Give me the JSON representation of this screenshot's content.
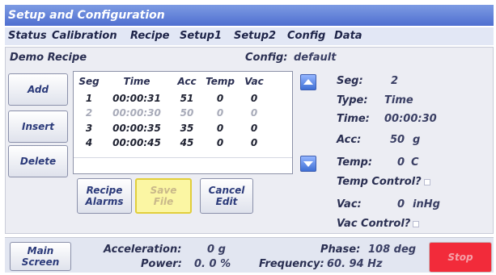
{
  "window": {
    "title": "Setup and Configuration"
  },
  "tabs": [
    {
      "label": "Status"
    },
    {
      "label": "Calibration"
    },
    {
      "label": "Recipe"
    },
    {
      "label": "Setup1"
    },
    {
      "label": "Setup2"
    },
    {
      "label": "Config"
    },
    {
      "label": "Data"
    }
  ],
  "recipe": {
    "name": "Demo Recipe",
    "config_label": "Config:",
    "config_value": "default"
  },
  "side_buttons": {
    "add": "Add",
    "insert": "Insert",
    "delete": "Delete"
  },
  "table": {
    "headers": [
      "Seg",
      "Time",
      "Acc",
      "Temp",
      "Vac"
    ],
    "rows": [
      [
        "1",
        "00:00:31",
        "51",
        "0",
        "0"
      ],
      [
        "2",
        "00:00:30",
        "50",
        "0",
        "0"
      ],
      [
        "3",
        "00:00:35",
        "35",
        "0",
        "0"
      ],
      [
        "4",
        "00:00:45",
        "45",
        "0",
        "0"
      ]
    ]
  },
  "bottom_buttons": {
    "recipe_alarms": [
      "Recipe",
      "Alarms"
    ],
    "save_file": [
      "Save",
      "File"
    ],
    "cancel_edit": [
      "Cancel",
      "Edit"
    ]
  },
  "segment_detail": {
    "seg_label": "Seg:",
    "seg_value": "2",
    "type_label": "Type:",
    "type_value": "Time",
    "time_label": "Time:",
    "time_value": "00:00:30",
    "acc_label": "Acc:",
    "acc_value": "50",
    "acc_unit": "g",
    "temp_label": "Temp:",
    "temp_value": "0",
    "temp_unit": "C",
    "temp_control_label": "Temp Control?",
    "vac_label": "Vac:",
    "vac_value": "0",
    "vac_unit": "inHg",
    "vac_control_label": "Vac Control?"
  },
  "footer": {
    "main_screen": [
      "Main",
      "Screen"
    ],
    "acceleration_label": "Acceleration:",
    "acceleration_value": "0 g",
    "power_label": "Power:",
    "power_value": "0. 0 %",
    "phase_label": "Phase:",
    "phase_value": "108 deg",
    "frequency_label": "Frequency:",
    "frequency_value": "60. 94 Hz",
    "stop": "Stop"
  },
  "icons": {
    "up": "arrow-up-icon",
    "down": "arrow-down-icon"
  },
  "colors": {
    "title_bar": "#5a78d6",
    "save_button": "#fbf6a3",
    "stop_button": "#f22b3a"
  }
}
